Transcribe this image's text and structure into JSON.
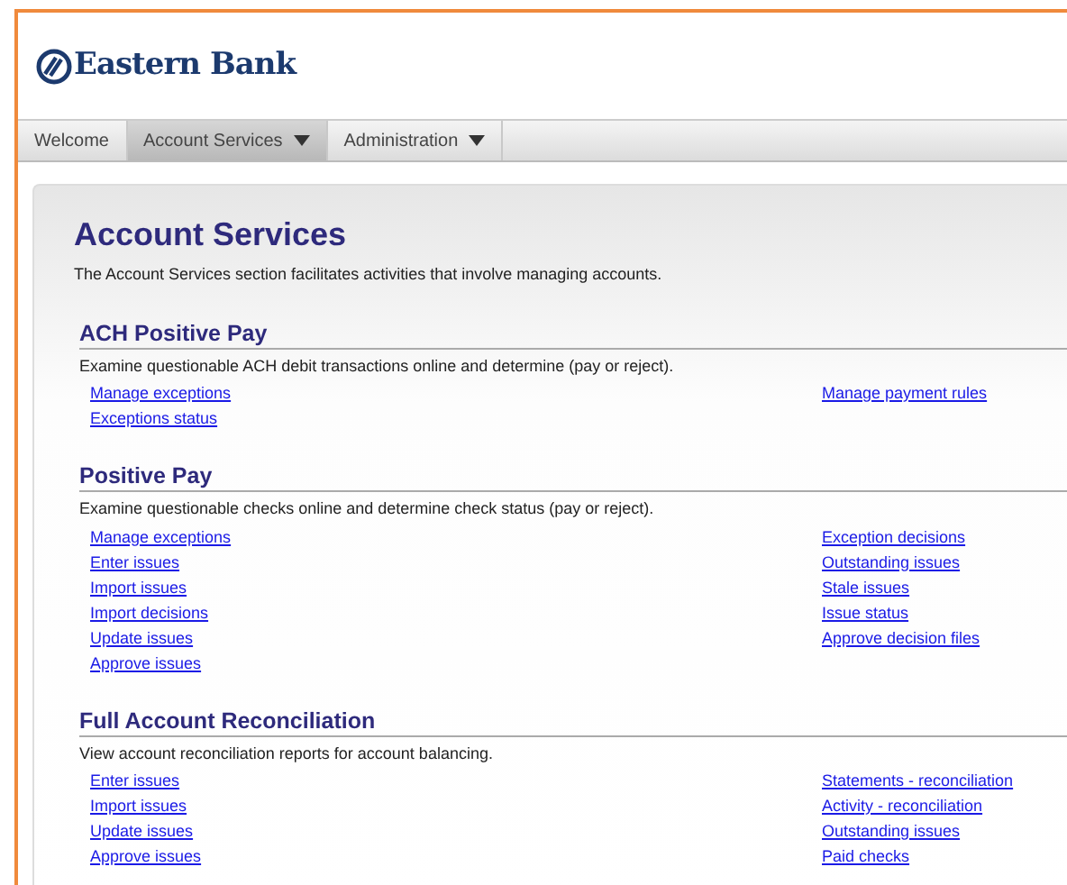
{
  "logo": {
    "text": "Eastern Bank"
  },
  "nav": [
    {
      "label": "Welcome",
      "selected": false,
      "has_menu": false
    },
    {
      "label": "Account Services",
      "selected": true,
      "has_menu": true
    },
    {
      "label": "Administration",
      "selected": false,
      "has_menu": true
    }
  ],
  "page": {
    "title": "Account Services",
    "description": "The Account Services section facilitates activities that involve managing accounts."
  },
  "sections": [
    {
      "heading": "ACH Positive Pay",
      "description": "Examine questionable ACH debit transactions online and determine (pay or reject).",
      "left_links": [
        "Manage exceptions",
        "Exceptions status"
      ],
      "right_links": [
        "Manage payment rules"
      ]
    },
    {
      "heading": "Positive Pay",
      "description": "Examine questionable checks online and determine check status (pay or reject).",
      "left_links": [
        "Manage exceptions",
        "Enter issues",
        "Import issues",
        "Import decisions",
        "Update issues",
        "Approve issues"
      ],
      "right_links": [
        "Exception decisions",
        "Outstanding issues",
        "Stale issues",
        "Issue status",
        "Approve decision files"
      ]
    },
    {
      "heading": "Full Account Reconciliation",
      "description": "View account reconciliation reports for account balancing.",
      "left_links": [
        "Enter issues",
        "Import issues",
        "Update issues",
        "Approve issues"
      ],
      "right_links": [
        "Statements - reconciliation",
        "Activity - reconciliation",
        "Outstanding issues",
        "Paid checks"
      ]
    }
  ]
}
